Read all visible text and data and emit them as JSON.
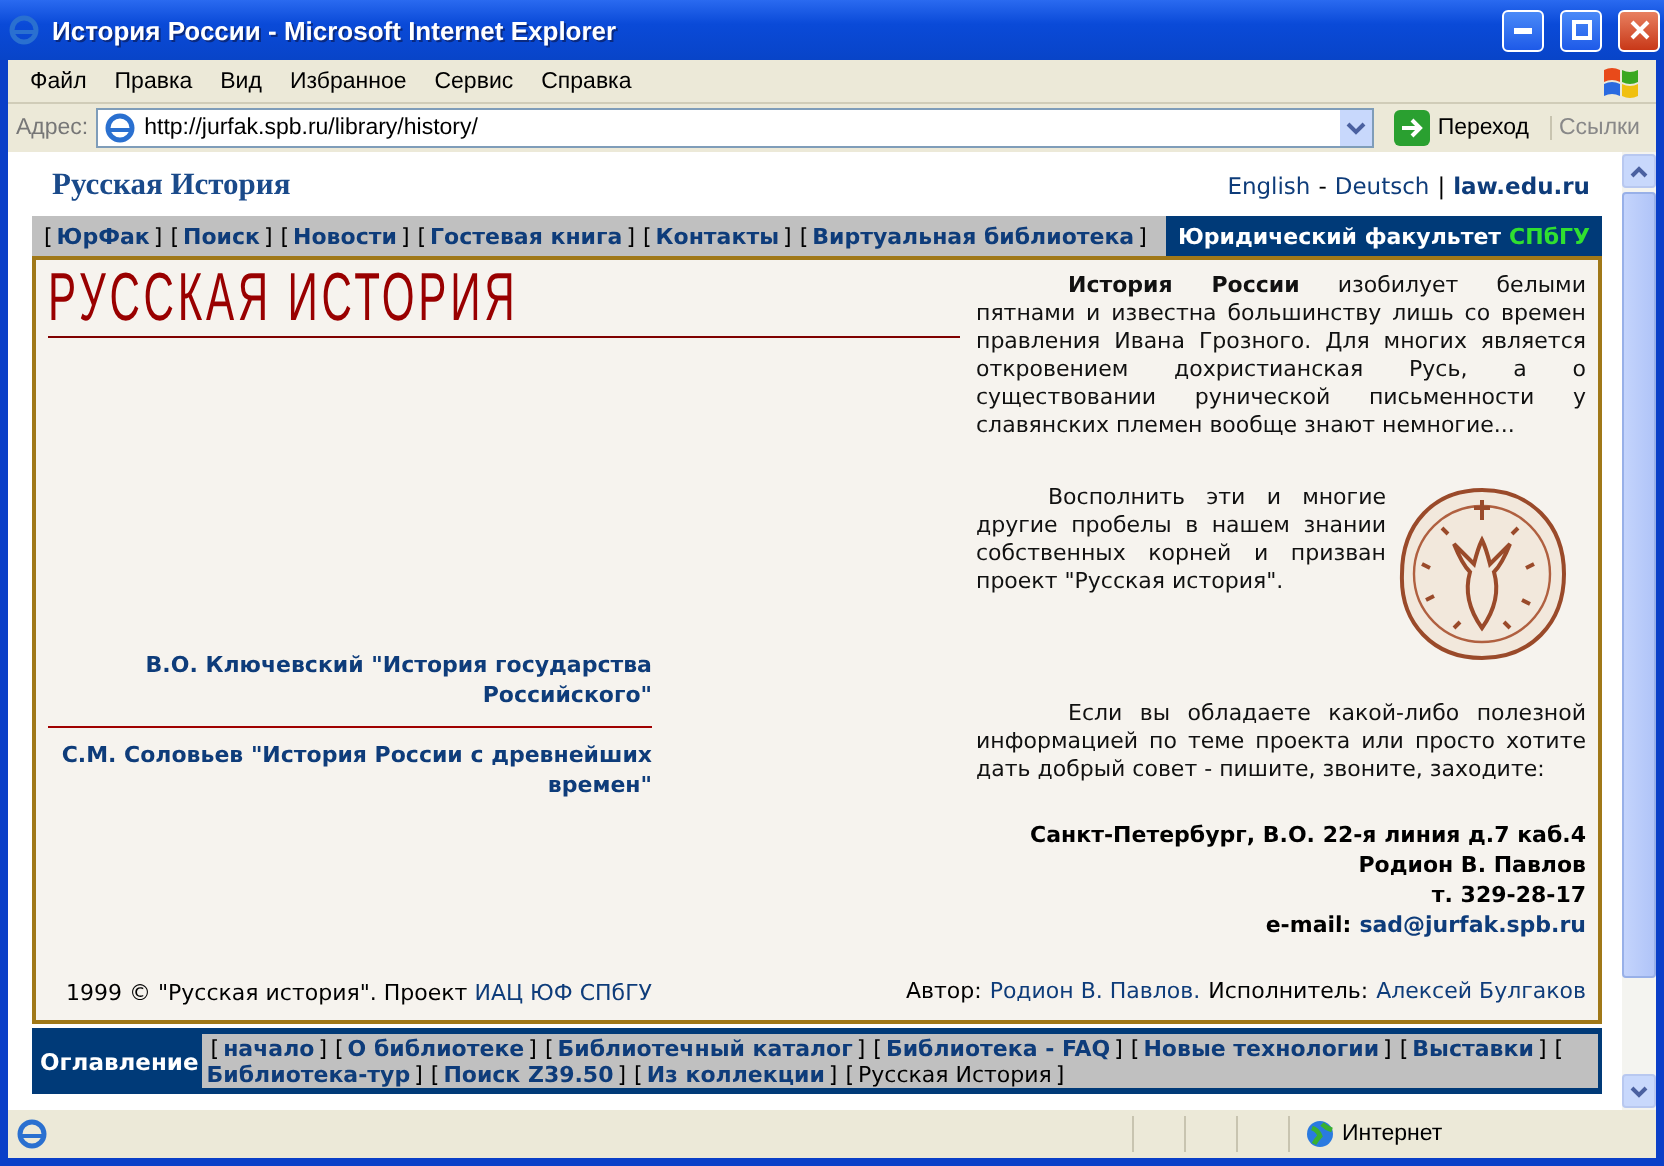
{
  "window": {
    "title": "История России - Microsoft Internet Explorer"
  },
  "menu": [
    "Файл",
    "Правка",
    "Вид",
    "Избранное",
    "Сервис",
    "Справка"
  ],
  "address_bar": {
    "label": "Адрес:",
    "url": "http://jurfak.spb.ru/library/history/",
    "go": "Переход",
    "links": "Ссылки"
  },
  "site_header": {
    "title": "Русская История",
    "languages": [
      "English",
      "Deutsch"
    ],
    "language_separator": "-",
    "separator": "|",
    "home_link": "law.edu.ru"
  },
  "top_nav": {
    "bracket_open": "[",
    "bracket_close": "]",
    "items": [
      "ЮрФак",
      "Поиск",
      "Новости",
      "Гостевая книга",
      "Контакты",
      "Виртуальная библиотека"
    ],
    "faculty": "Юридический факультет",
    "university": "СПбГУ"
  },
  "logo": "РУССКАЯ ИСТОРИЯ",
  "books": [
    "В.О. Ключевский \"История государства Российского\"",
    "С.М. Соловьев \"История России с древнейших времен\""
  ],
  "copyright": {
    "text": "1999 © \"Русская история\". Проект",
    "link": "ИАЦ ЮФ СПбГУ"
  },
  "intro": "**История России** изобилует белыми пятнами и известна большинству лишь со времен правления Ивана Грозного. Для многих является откровением дохристианская Русь, а о существовании рунической письменности у славянских племен вообще знают немногие...",
  "project_text": "Восполнить эти и многие другие пробелы в нашем знании собственных корней и призван проект \"Русская история\".",
  "contact_text": "Если вы обладаете какой-либо полезной информацией по теме проекта или просто хотите дать добрый совет - пишите, звоните, заходите:",
  "contact": {
    "address": "Санкт-Петербург, В.О. 22-я линия д.7 каб.4",
    "name": "Родион В. Павлов",
    "phone": "т. 329-28-17",
    "email_label": "e-mail:",
    "email": "sad@jurfak.spb.ru"
  },
  "credits": {
    "author_label": "Автор:",
    "author": "Родион В. Павлов.",
    "maker_label": "Исполнитель:",
    "maker": "Алексей Булгаков"
  },
  "bottom_nav": {
    "label": "Оглавление",
    "bracket_open": "[",
    "bracket_close": "]",
    "items": [
      {
        "label": "начало",
        "selected": false
      },
      {
        "label": "О библиотеке",
        "selected": false
      },
      {
        "label": "Библиотечный каталог",
        "selected": false
      },
      {
        "label": "Библиотека - FAQ",
        "selected": false
      },
      {
        "label": "Новые технологии",
        "selected": false
      },
      {
        "label": "Выставки",
        "selected": false
      },
      {
        "label": "Библиотека-тур",
        "selected": false
      },
      {
        "label": "Поиск Z39.50",
        "selected": false
      },
      {
        "label": "Из коллекции",
        "selected": false
      },
      {
        "label": "Русская История",
        "selected": true
      }
    ]
  },
  "status_bar": {
    "zone": "Интернет"
  }
}
